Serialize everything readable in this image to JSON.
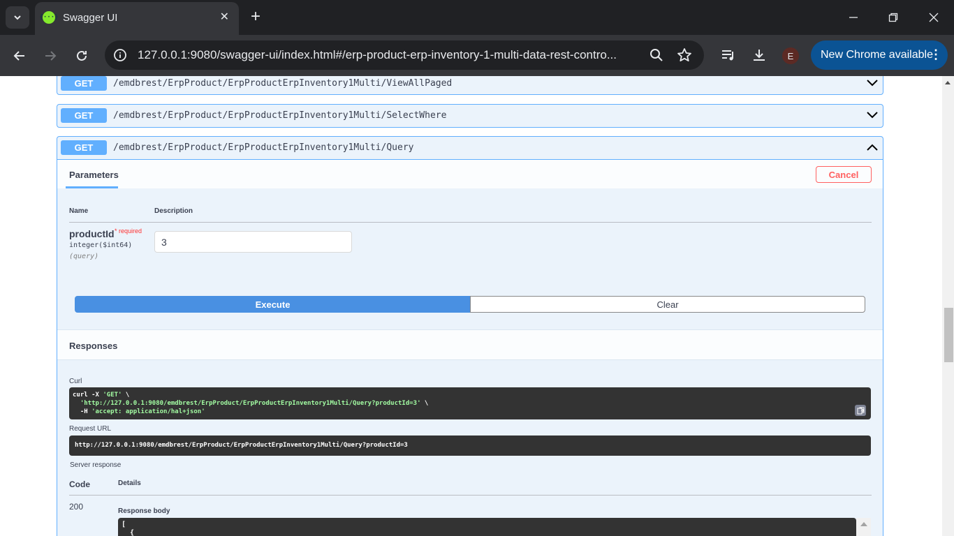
{
  "browser": {
    "tab_title": "Swagger UI",
    "favicon_text": "{···}",
    "address": "127.0.0.1:9080/swagger-ui/index.html#/erp-product-erp-inventory-1-multi-data-rest-contro...",
    "profile_initial": "E",
    "update_button": "New Chrome available",
    "update_menu": "⋮"
  },
  "operations": [
    {
      "method": "GET",
      "path": "/emdbrest/ErpProduct/ErpProductErpInventory1Multi/ViewAllPaged",
      "expanded": false
    },
    {
      "method": "GET",
      "path": "/emdbrest/ErpProduct/ErpProductErpInventory1Multi/SelectWhere",
      "expanded": false
    },
    {
      "method": "GET",
      "path": "/emdbrest/ErpProduct/ErpProductErpInventory1Multi/Query",
      "expanded": true
    }
  ],
  "query_op": {
    "parameters_tab": "Parameters",
    "cancel_label": "Cancel",
    "columns": {
      "name": "Name",
      "description": "Description"
    },
    "param": {
      "name": "productId",
      "required": "* required",
      "type": "integer($int64)",
      "location": "(query)",
      "value": "3"
    },
    "execute_label": "Execute",
    "clear_label": "Clear",
    "responses_title": "Responses",
    "curl_label": "Curl",
    "curl": {
      "line1_cmd": "curl -X ",
      "line1_method": "'GET'",
      "line1_tail": " \\",
      "line2_url": "'http://127.0.0.1:9080/emdbrest/ErpProduct/ErpProductErpInventory1Multi/Query?productId=3'",
      "line2_tail": " \\",
      "line3_flag": "  -H ",
      "line3_header": "'accept: application/hal+json'"
    },
    "request_url_label": "Request URL",
    "request_url": "http://127.0.0.1:9080/emdbrest/ErpProduct/ErpProductErpInventory1Multi/Query?productId=3",
    "server_response_label": "Server response",
    "code_col": "Code",
    "details_col": "Details",
    "status_code": "200",
    "response_body_label": "Response body",
    "response_body": "[\n  {"
  }
}
